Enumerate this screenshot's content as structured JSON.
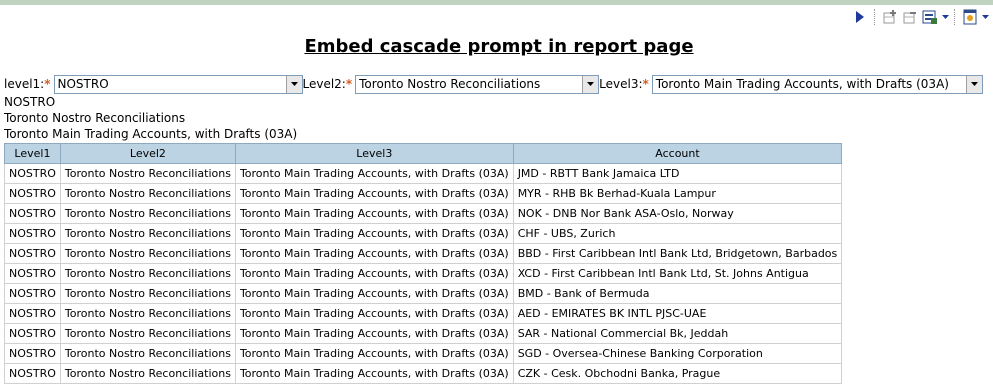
{
  "toolbar": {
    "icons": [
      "run-icon",
      "add-row-icon",
      "remove-row-icon",
      "export-icon",
      "options-icon"
    ]
  },
  "title": "Embed cascade prompt in report page",
  "prompts": {
    "level1": {
      "label": "level1:",
      "required_mark": "*",
      "value": "NOSTRO"
    },
    "level2": {
      "label": "Level2:",
      "required_mark": "*",
      "value": "Toronto Nostro Reconciliations"
    },
    "level3": {
      "label": "Level3:",
      "required_mark": "*",
      "value": "Toronto Main Trading Accounts, with Drafts (03A)"
    }
  },
  "echo": {
    "line1": "NOSTRO",
    "line2": "Toronto Nostro Reconciliations",
    "line3": "Toronto Main Trading Accounts, with Drafts (03A)"
  },
  "table": {
    "headers": [
      "Level1",
      "Level2",
      "Level3",
      "Account"
    ],
    "rows": [
      [
        "NOSTRO",
        "Toronto Nostro Reconciliations",
        "Toronto Main Trading Accounts, with Drafts (03A)",
        "JMD - RBTT Bank Jamaica LTD"
      ],
      [
        "NOSTRO",
        "Toronto Nostro Reconciliations",
        "Toronto Main Trading Accounts, with Drafts (03A)",
        "MYR - RHB Bk Berhad-Kuala Lampur"
      ],
      [
        "NOSTRO",
        "Toronto Nostro Reconciliations",
        "Toronto Main Trading Accounts, with Drafts (03A)",
        "NOK - DNB Nor Bank ASA-Oslo, Norway"
      ],
      [
        "NOSTRO",
        "Toronto Nostro Reconciliations",
        "Toronto Main Trading Accounts, with Drafts (03A)",
        "CHF - UBS, Zurich"
      ],
      [
        "NOSTRO",
        "Toronto Nostro Reconciliations",
        "Toronto Main Trading Accounts, with Drafts (03A)",
        "BBD - First Caribbean Intl Bank Ltd, Bridgetown, Barbados"
      ],
      [
        "NOSTRO",
        "Toronto Nostro Reconciliations",
        "Toronto Main Trading Accounts, with Drafts (03A)",
        "XCD - First Caribbean Intl Bank Ltd, St. Johns Antigua"
      ],
      [
        "NOSTRO",
        "Toronto Nostro Reconciliations",
        "Toronto Main Trading Accounts, with Drafts (03A)",
        "BMD - Bank of Bermuda"
      ],
      [
        "NOSTRO",
        "Toronto Nostro Reconciliations",
        "Toronto Main Trading Accounts, with Drafts (03A)",
        "AED - EMIRATES BK INTL PJSC-UAE"
      ],
      [
        "NOSTRO",
        "Toronto Nostro Reconciliations",
        "Toronto Main Trading Accounts, with Drafts (03A)",
        "SAR - National Commercial Bk, Jeddah"
      ],
      [
        "NOSTRO",
        "Toronto Nostro Reconciliations",
        "Toronto Main Trading Accounts, with Drafts (03A)",
        "SGD - Oversea-Chinese Banking Corporation"
      ],
      [
        "NOSTRO",
        "Toronto Nostro Reconciliations",
        "Toronto Main Trading Accounts, with Drafts (03A)",
        "CZK - Cesk. Obchodni Banka, Prague"
      ]
    ]
  }
}
